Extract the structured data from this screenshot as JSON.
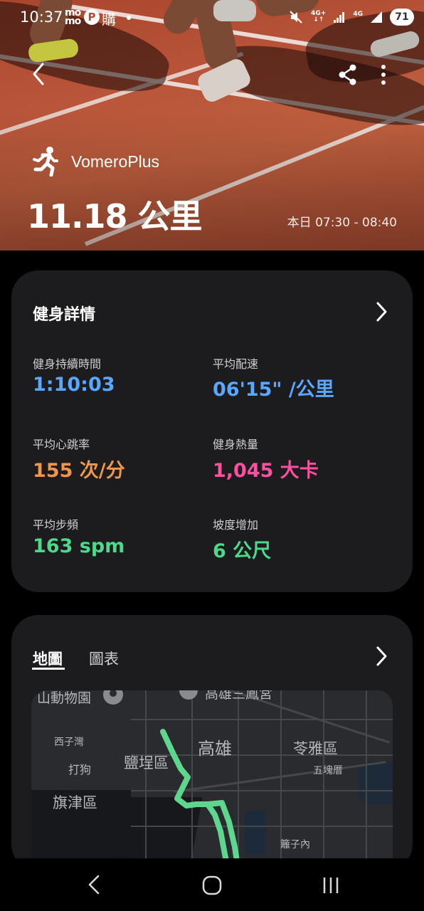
{
  "status_bar": {
    "time": "10:37",
    "carrier_top": "mo",
    "carrier_bottom": "mo",
    "p_icon": "P",
    "kanji_icon": "購",
    "network1": "4G+",
    "network2": "4G",
    "battery": "71"
  },
  "header": {
    "device_name": "VomeroPlus",
    "distance": "11.18 公里",
    "time_range": "本日 07:30 - 08:40"
  },
  "details": {
    "title": "健身詳情",
    "metrics": [
      {
        "label": "健身持續時間",
        "value": "1:10:03",
        "color": "#5aa7ff"
      },
      {
        "label": "平均配速",
        "value": "06'15\" /公里",
        "color": "#5aa7ff"
      },
      {
        "label": "平均心跳率",
        "value": "155 次/分",
        "color": "#f0954c"
      },
      {
        "label": "健身熱量",
        "value": "1,045 大卡",
        "color": "#ff4fa0"
      },
      {
        "label": "平均步頻",
        "value": "163 spm",
        "color": "#4cd98a"
      },
      {
        "label": "坡度增加",
        "value": "6 公尺",
        "color": "#4cd98a"
      }
    ]
  },
  "map_section": {
    "tabs": [
      {
        "label": "地圖",
        "active": true
      },
      {
        "label": "圖表",
        "active": false
      }
    ],
    "map_labels": {
      "zoo": "山動物園",
      "top_cut": "高雄三鳳宮",
      "xiziwan": "西子灣",
      "dagou": "打狗",
      "yancheng": "鹽埕區",
      "kaohsiung": "高雄",
      "lingya": "苓雅區",
      "wukuaicuo": "五塊厝",
      "qijin": "旗津區",
      "lizinei": "籬子內"
    },
    "route_color": "#5fd68e"
  },
  "icons": {
    "back": "back-arrow-icon",
    "share": "share-icon",
    "more": "more-vertical-icon",
    "runner": "runner-icon",
    "chevron": "chevron-right-icon"
  }
}
